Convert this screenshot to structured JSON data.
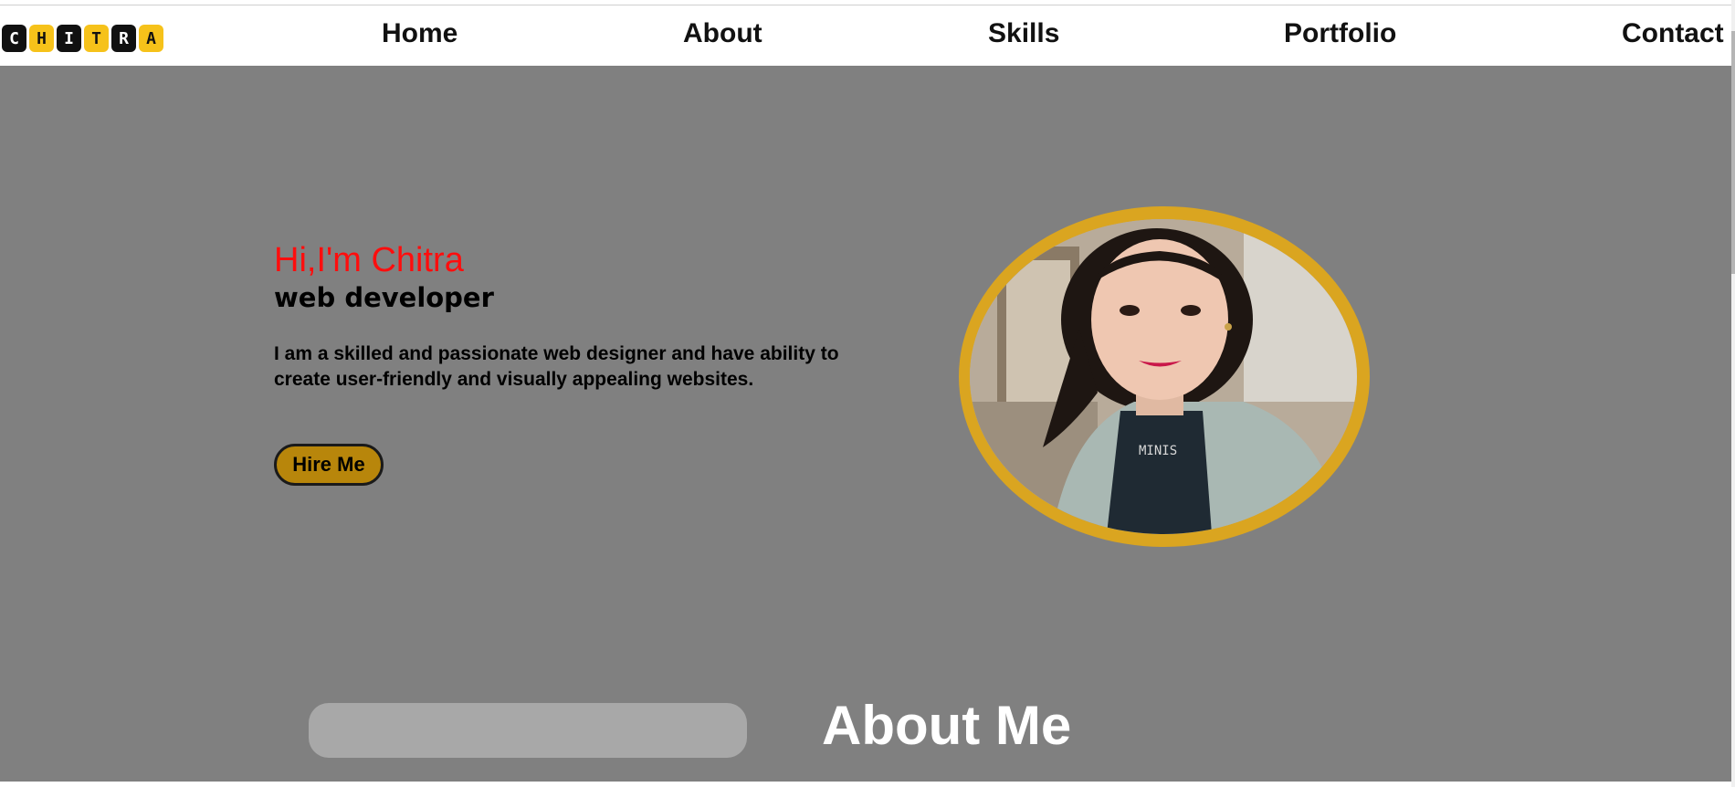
{
  "nav": {
    "logo_letters": [
      "C",
      "H",
      "I",
      "T",
      "R",
      "A"
    ],
    "items": [
      {
        "label": "Home"
      },
      {
        "label": "About"
      },
      {
        "label": "Skills"
      },
      {
        "label": "Portfolio"
      },
      {
        "label": "Contact"
      }
    ]
  },
  "hero": {
    "greeting": "Hi,I'm Chitra",
    "role": "web developer",
    "description": "I am a skilled and passionate web designer and have ability to create user-friendly and visually appealing websites.",
    "button_label": "Hire Me",
    "next_section_title": "About Me"
  },
  "colors": {
    "hero_bg": "#808080",
    "greeting": "#ff0d0d",
    "accent_gold": "#daa520",
    "button": "#b8860b",
    "logo_yellow": "#f6c21a"
  }
}
